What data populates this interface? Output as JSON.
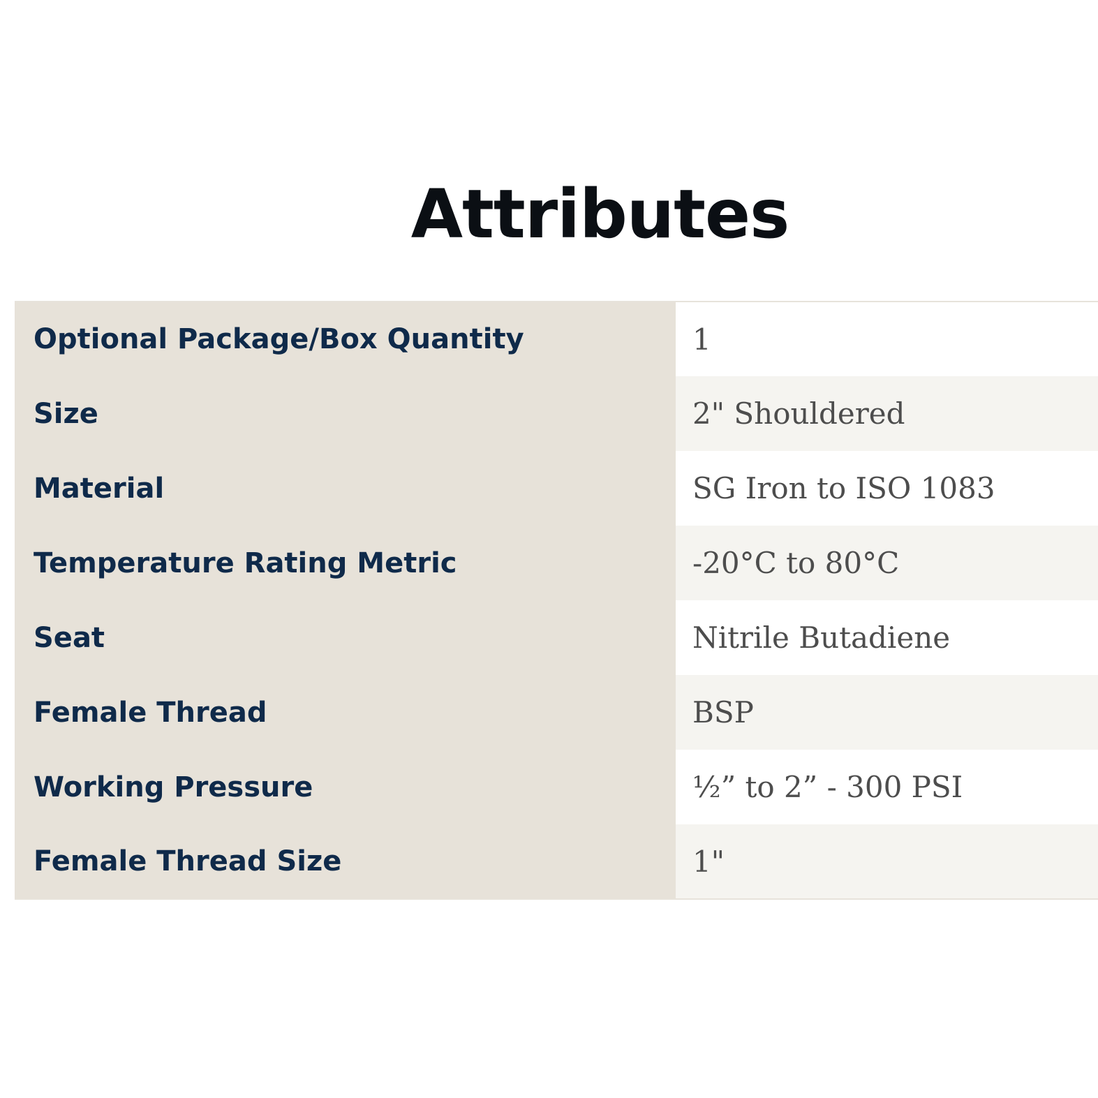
{
  "page": {
    "title": "Attributes"
  },
  "attributes": {
    "rows": [
      {
        "name": "Optional Package/Box Quantity",
        "value": "1"
      },
      {
        "name": "Size",
        "value": "2\" Shouldered"
      },
      {
        "name": "Material",
        "value": "SG Iron to ISO 1083"
      },
      {
        "name": "Temperature Rating Metric",
        "value": "-20°C to 80°C"
      },
      {
        "name": "Seat",
        "value": "Nitrile Butadiene"
      },
      {
        "name": "Female Thread",
        "value": "BSP"
      },
      {
        "name": "Working Pressure",
        "value": "½” to 2” - 300 PSI"
      },
      {
        "name": "Female Thread Size",
        "value": "1\""
      }
    ]
  },
  "colors": {
    "label_bg": "#e7e2d9",
    "label_text": "#0f2a4a",
    "value_text": "#4d4d4d",
    "alt_row_bg": "#f5f4f0",
    "title_text": "#0b0f14"
  }
}
